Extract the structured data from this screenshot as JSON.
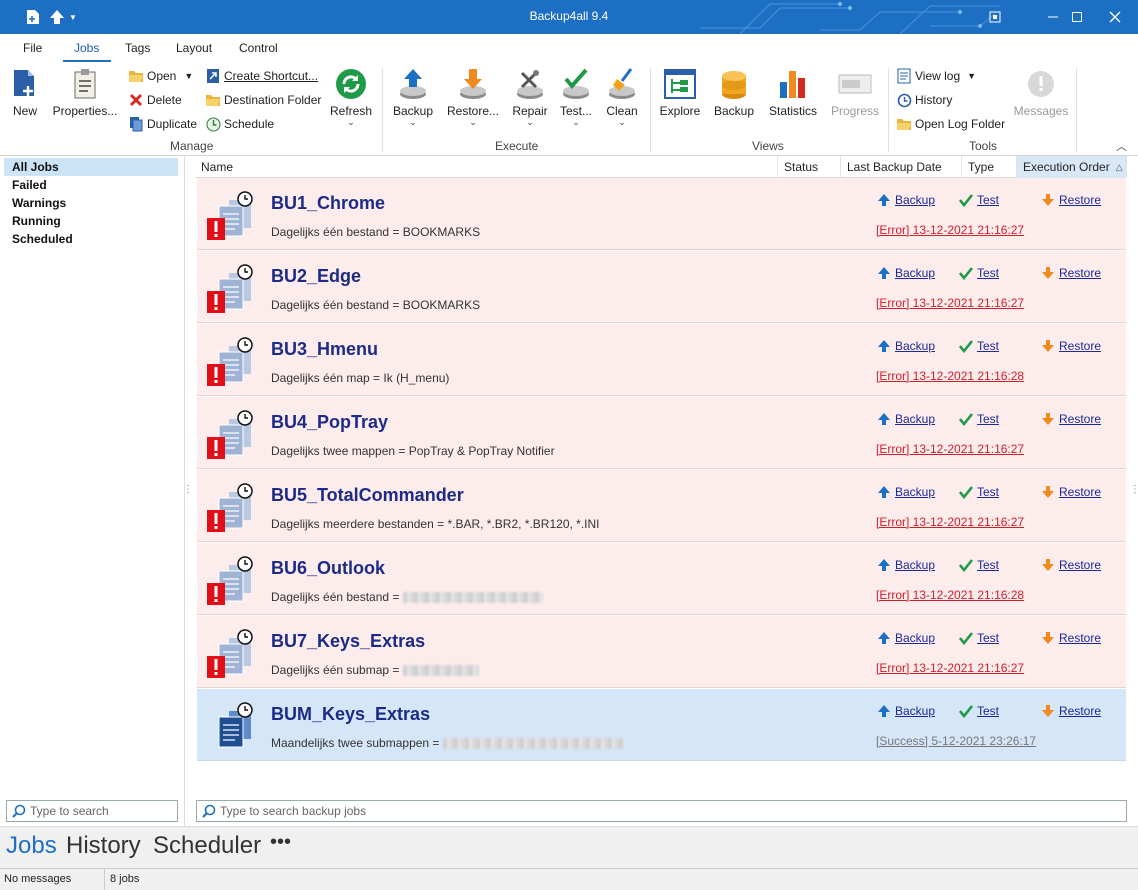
{
  "window": {
    "title": "Backup4all 9.4"
  },
  "menu_tabs": [
    "File",
    "Jobs",
    "Tags",
    "Layout",
    "Control"
  ],
  "ribbon": {
    "manage": {
      "label": "Manage",
      "new": "New",
      "properties": "Properties...",
      "open": "Open",
      "delete": "Delete",
      "duplicate": "Duplicate",
      "create_shortcut": "Create Shortcut...",
      "destination_folder": "Destination Folder",
      "schedule": "Schedule",
      "refresh": "Refresh"
    },
    "execute": {
      "label": "Execute",
      "backup": "Backup",
      "restore": "Restore...",
      "repair": "Repair",
      "test": "Test...",
      "clean": "Clean"
    },
    "views": {
      "label": "Views",
      "explore": "Explore",
      "backup": "Backup",
      "statistics": "Statistics",
      "progress": "Progress"
    },
    "tools": {
      "label": "Tools",
      "view_log": "View log",
      "history": "History",
      "open_log_folder": "Open Log Folder",
      "messages": "Messages"
    }
  },
  "filters": [
    "All Jobs",
    "Failed",
    "Warnings",
    "Running",
    "Scheduled"
  ],
  "left_search": {
    "placeholder": "Type to search"
  },
  "columns": [
    "Name",
    "Status",
    "Last Backup Date",
    "Type",
    "Execution Order"
  ],
  "job_actions": {
    "backup": "Backup",
    "test": "Test",
    "restore": "Restore"
  },
  "jobs": [
    {
      "name": "BU1_Chrome",
      "desc": "Dagelijks één bestand  =  BOOKMARKS",
      "status": "[Error] 13-12-2021 21:16:27",
      "state": "error"
    },
    {
      "name": "BU2_Edge",
      "desc": "Dagelijks één bestand  =  BOOKMARKS",
      "status": "[Error] 13-12-2021 21:16:27",
      "state": "error"
    },
    {
      "name": "BU3_Hmenu",
      "desc": "Dagelijks één map  =  Ik (H_menu)",
      "status": "[Error] 13-12-2021 21:16:28",
      "state": "error"
    },
    {
      "name": "BU4_PopTray",
      "desc": "Dagelijks twee mappen  =  PopTray  &  PopTray Notifier",
      "status": "[Error] 13-12-2021 21:16:27",
      "state": "error"
    },
    {
      "name": "BU5_TotalCommander",
      "desc": "Dagelijks meerdere bestanden  =  *.BAR, *.BR2, *.BR120, *.INI",
      "status": "[Error] 13-12-2021 21:16:27",
      "state": "error"
    },
    {
      "name": "BU6_Outlook",
      "desc": "Dagelijks één bestand  =",
      "status": "[Error] 13-12-2021 21:16:28",
      "state": "error"
    },
    {
      "name": "BU7_Keys_Extras",
      "desc": "Dagelijks één submap  =",
      "status": "[Error] 13-12-2021 21:16:27",
      "state": "error"
    },
    {
      "name": "BUM_Keys_Extras",
      "desc": "Maandelijks twee submappen  =",
      "status": "[Success] 5-12-2021 23:26:17",
      "state": "success"
    }
  ],
  "main_search": {
    "placeholder": "Type to search backup jobs"
  },
  "bottom_nav": {
    "jobs": "Jobs",
    "history": "History",
    "scheduler": "Scheduler",
    "more": "•••"
  },
  "statusbar": {
    "messages": "No messages",
    "jobs_count": "8 jobs"
  },
  "colors": {
    "titlebar": "#1d6fc4",
    "error_row": "#fdecec",
    "success_row": "#d5e6f8",
    "error_text": "#d0202a",
    "job_name": "#1c2b87"
  }
}
